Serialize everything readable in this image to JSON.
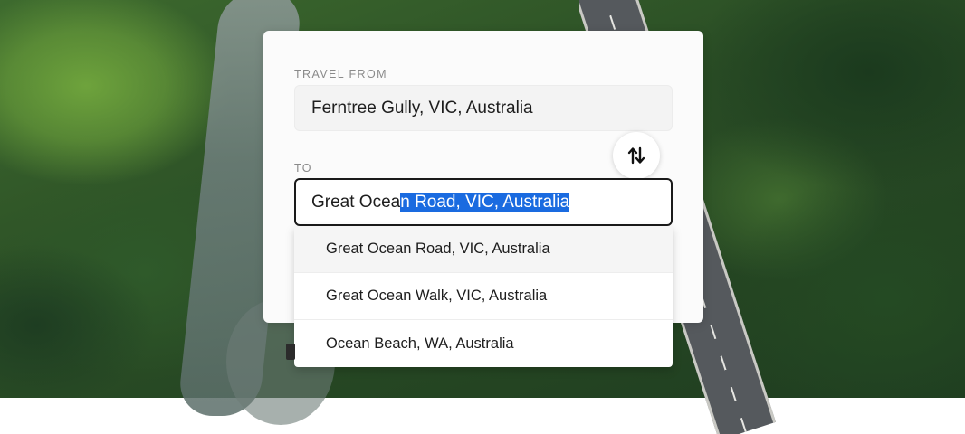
{
  "form": {
    "from_label": "TRAVEL FROM",
    "from_value": "Ferntree Gully, VIC, Australia",
    "to_label": "TO",
    "to_value_typed": "Great Ocea",
    "to_value_selected": "n Road, VIC, Australia",
    "swap_icon": "swap-vertical-arrows-icon"
  },
  "suggestions": [
    {
      "label": "Great Ocean Road, VIC, Australia",
      "highlighted": true
    },
    {
      "label": "Great Ocean Walk, VIC, Australia",
      "highlighted": false
    },
    {
      "label": "Ocean Beach, WA, Australia",
      "highlighted": false
    }
  ],
  "colors": {
    "selection": "#1a6be0",
    "card": "#fbfbfb",
    "focused_border": "#1a1a1a"
  }
}
